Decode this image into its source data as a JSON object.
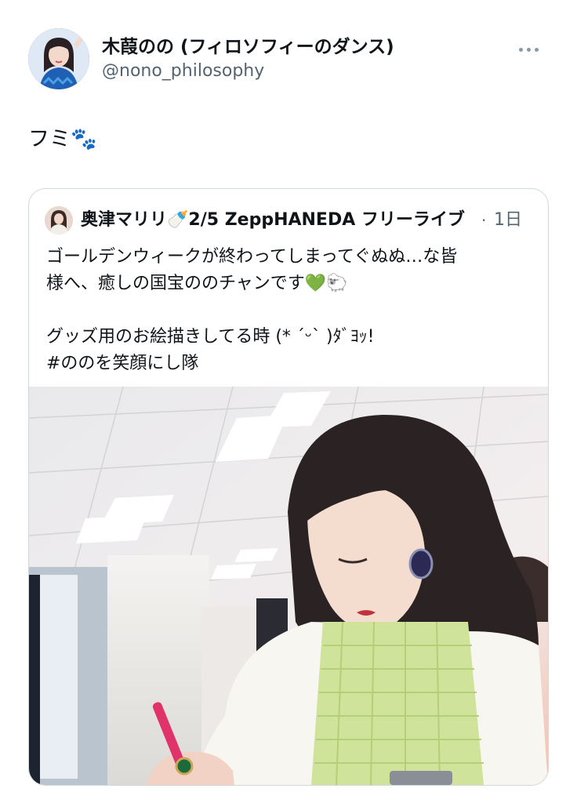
{
  "tweet": {
    "display_name": "木葭のの (フィロソフィーのダンス)",
    "handle": "@nono_philosophy",
    "text": "フミ🐾",
    "more_icon": "more-horizontal-icon"
  },
  "quoted": {
    "name_line": "奥津マリリ🍼2/5 ZeppHANEDA フリーライブ",
    "time": "1日",
    "separator": "·",
    "lines": [
      "ゴールデンウィークが終わってしまってぐぬぬ…な皆",
      "様へ、癒しの国宝ののチャンです💚🐑",
      "",
      "グッズ用のお絵描きしてる時 (* ˊᵕˋ )ﾀﾞﾖｯ!",
      "#ののを笑顔にし隊"
    ]
  },
  "colors": {
    "text": "#0f1419",
    "secondary": "#536471",
    "border": "#cfd9de"
  }
}
